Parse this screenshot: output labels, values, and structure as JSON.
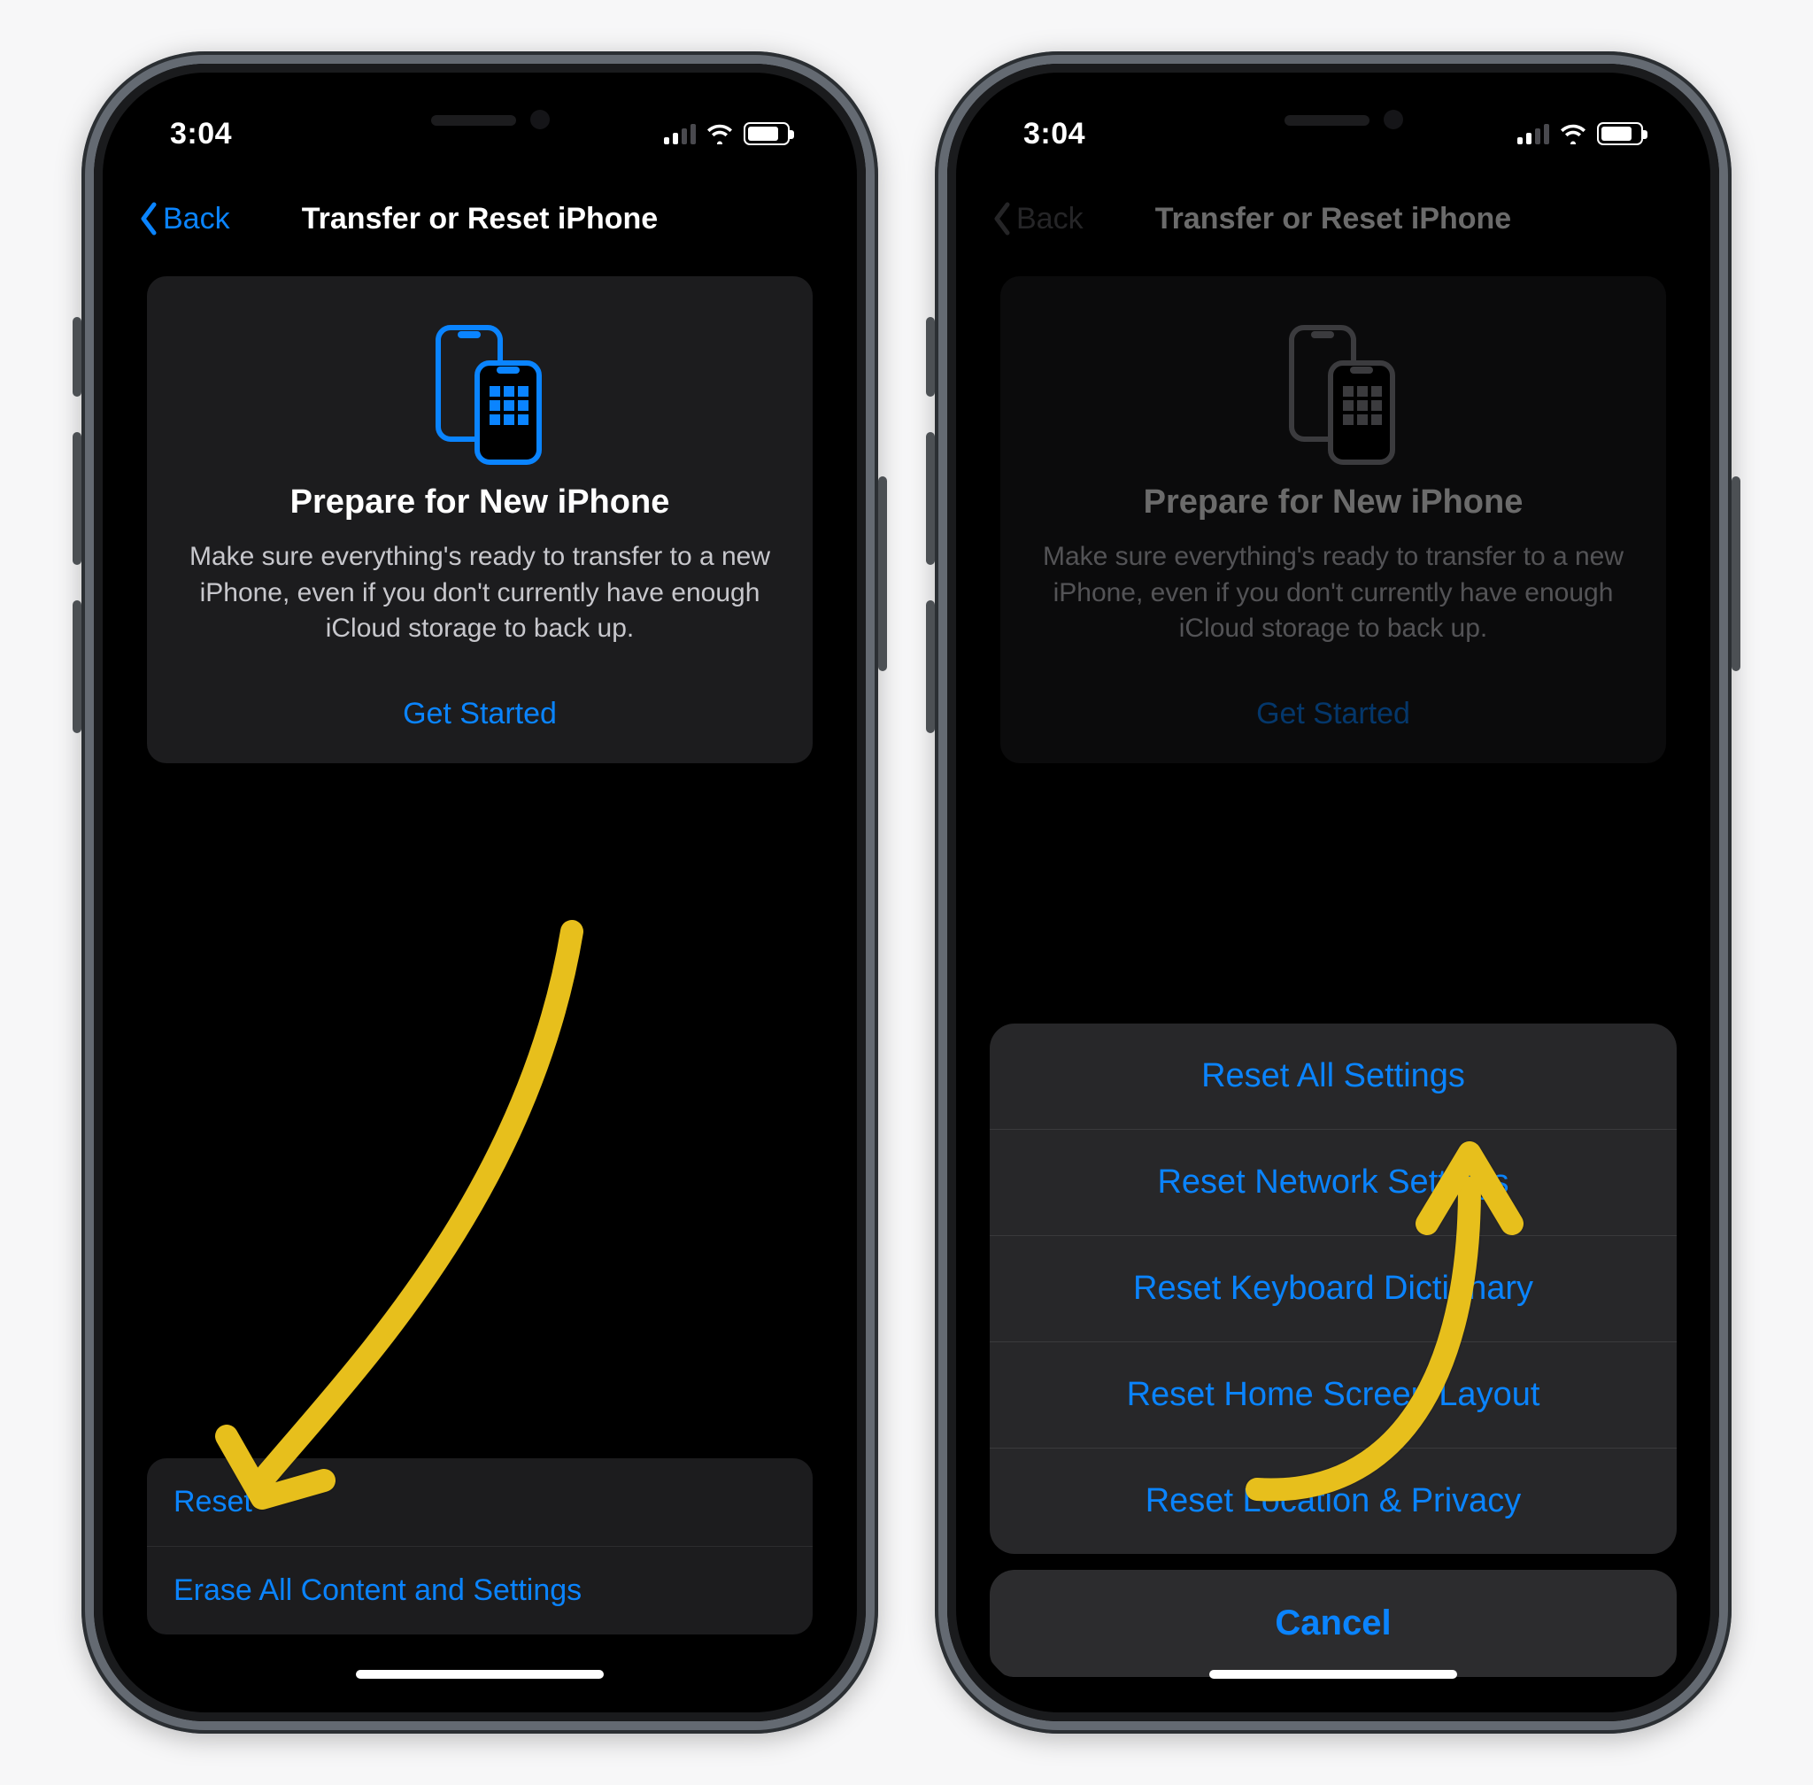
{
  "colors": {
    "accent": "#0a84ff",
    "annotation": "#e7bf1c",
    "card_bg": "#1c1c1e"
  },
  "status": {
    "time": "3:04"
  },
  "nav": {
    "back_label": "Back",
    "title": "Transfer or Reset iPhone"
  },
  "prepare_card": {
    "heading": "Prepare for New iPhone",
    "body": "Make sure everything's ready to transfer to a new iPhone, even if you don't currently have enough iCloud storage to back up.",
    "cta": "Get Started"
  },
  "left_screen": {
    "rows": [
      {
        "label": "Reset"
      },
      {
        "label": "Erase All Content and Settings"
      }
    ]
  },
  "right_screen": {
    "sheet": {
      "options": [
        {
          "label": "Reset All Settings"
        },
        {
          "label": "Reset Network Settings"
        },
        {
          "label": "Reset Keyboard Dictionary"
        },
        {
          "label": "Reset Home Screen Layout"
        },
        {
          "label": "Reset Location & Privacy"
        }
      ],
      "cancel": "Cancel"
    }
  }
}
